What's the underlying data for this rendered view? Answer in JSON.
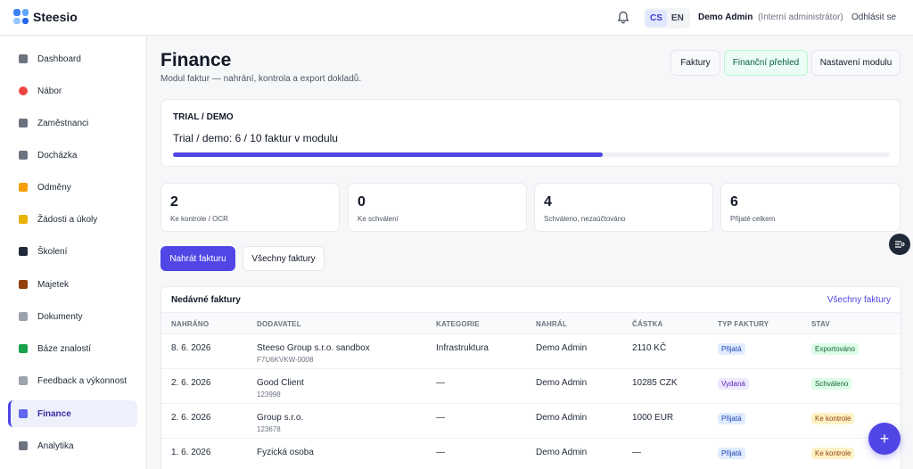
{
  "app": {
    "name": "Steesio"
  },
  "topbar": {
    "lang": [
      "CS",
      "EN"
    ],
    "user_name": "Demo Admin",
    "user_role": "(Interní administrátor)",
    "logout": "Odhlásit se"
  },
  "sidebar": {
    "items": [
      {
        "label": "Dashboard",
        "color": "#6b7280"
      },
      {
        "label": "Nábor",
        "color": "#ef4444"
      },
      {
        "label": "Zaměstnanci",
        "color": "#6b7280"
      },
      {
        "label": "Docházka",
        "color": "#6b7280"
      },
      {
        "label": "Odměny",
        "color": "#f59e0b"
      },
      {
        "label": "Žádosti a úkoly",
        "color": "#eab308"
      },
      {
        "label": "Školení",
        "color": "#1f2937"
      },
      {
        "label": "Majetek",
        "color": "#92400e"
      },
      {
        "label": "Dokumenty",
        "color": "#9ca3af"
      },
      {
        "label": "Báze znalostí",
        "color": "#16a34a"
      },
      {
        "label": "Feedback a výkonnost",
        "color": "#9ca3af"
      },
      {
        "label": "Finance",
        "color": "#6366f1"
      },
      {
        "label": "Analytika",
        "color": "#6b7280"
      }
    ]
  },
  "header": {
    "title": "Finance",
    "subtitle": "Modul faktur — nahrání, kontrola a export dokladů.",
    "buttons": [
      "Faktury",
      "Finanční přehled",
      "Nastavení modulu"
    ]
  },
  "trial": {
    "label": "TRIAL / DEMO",
    "text": "Trial / demo: 6 / 10 faktur v modulu",
    "progress": 0.6
  },
  "stats": [
    {
      "value": "2",
      "label": "Ke kontrole / OCR"
    },
    {
      "value": "0",
      "label": "Ke schválení"
    },
    {
      "value": "4",
      "label": "Schváleno, nezaúčtováno"
    },
    {
      "value": "6",
      "label": "Přijaté celkem"
    }
  ],
  "actions": {
    "upload": "Nahrát fakturu",
    "all": "Všechny faktury"
  },
  "table": {
    "title": "Nedávné faktury",
    "link": "Všechny faktury",
    "columns": [
      "NAHRÁNO",
      "DODAVATEL",
      "KATEGORIE",
      "NAHRÁL",
      "ČÁSTKA",
      "TYP FAKTURY",
      "STAV"
    ],
    "rows": [
      {
        "date": "8. 6. 2026",
        "supplier": "Steeso Group s.r.o. sandbox",
        "supplier_id": "F7U6KVKW-0008",
        "category": "Infrastruktura",
        "uploader": "Demo Admin",
        "amount": "2110 KČ",
        "type": "Přijatá",
        "status": "Exportováno"
      },
      {
        "date": "2. 6. 2026",
        "supplier": "Good Client",
        "supplier_id": "123998",
        "category": "—",
        "uploader": "Demo Admin",
        "amount": "10285 CZK",
        "type": "Vydaná",
        "status": "Schváleno"
      },
      {
        "date": "2. 6. 2026",
        "supplier": "Group s.r.o.",
        "supplier_id": "123678",
        "category": "—",
        "uploader": "Demo Admin",
        "amount": "1000 EUR",
        "type": "Přijatá",
        "status": "Ke kontrole"
      },
      {
        "date": "1. 6. 2026",
        "supplier": "Fyzická osoba",
        "supplier_id": "",
        "category": "—",
        "uploader": "Demo Admin",
        "amount": "—",
        "type": "Přijatá",
        "status": "Ke kontrole"
      }
    ]
  },
  "fab": "+"
}
